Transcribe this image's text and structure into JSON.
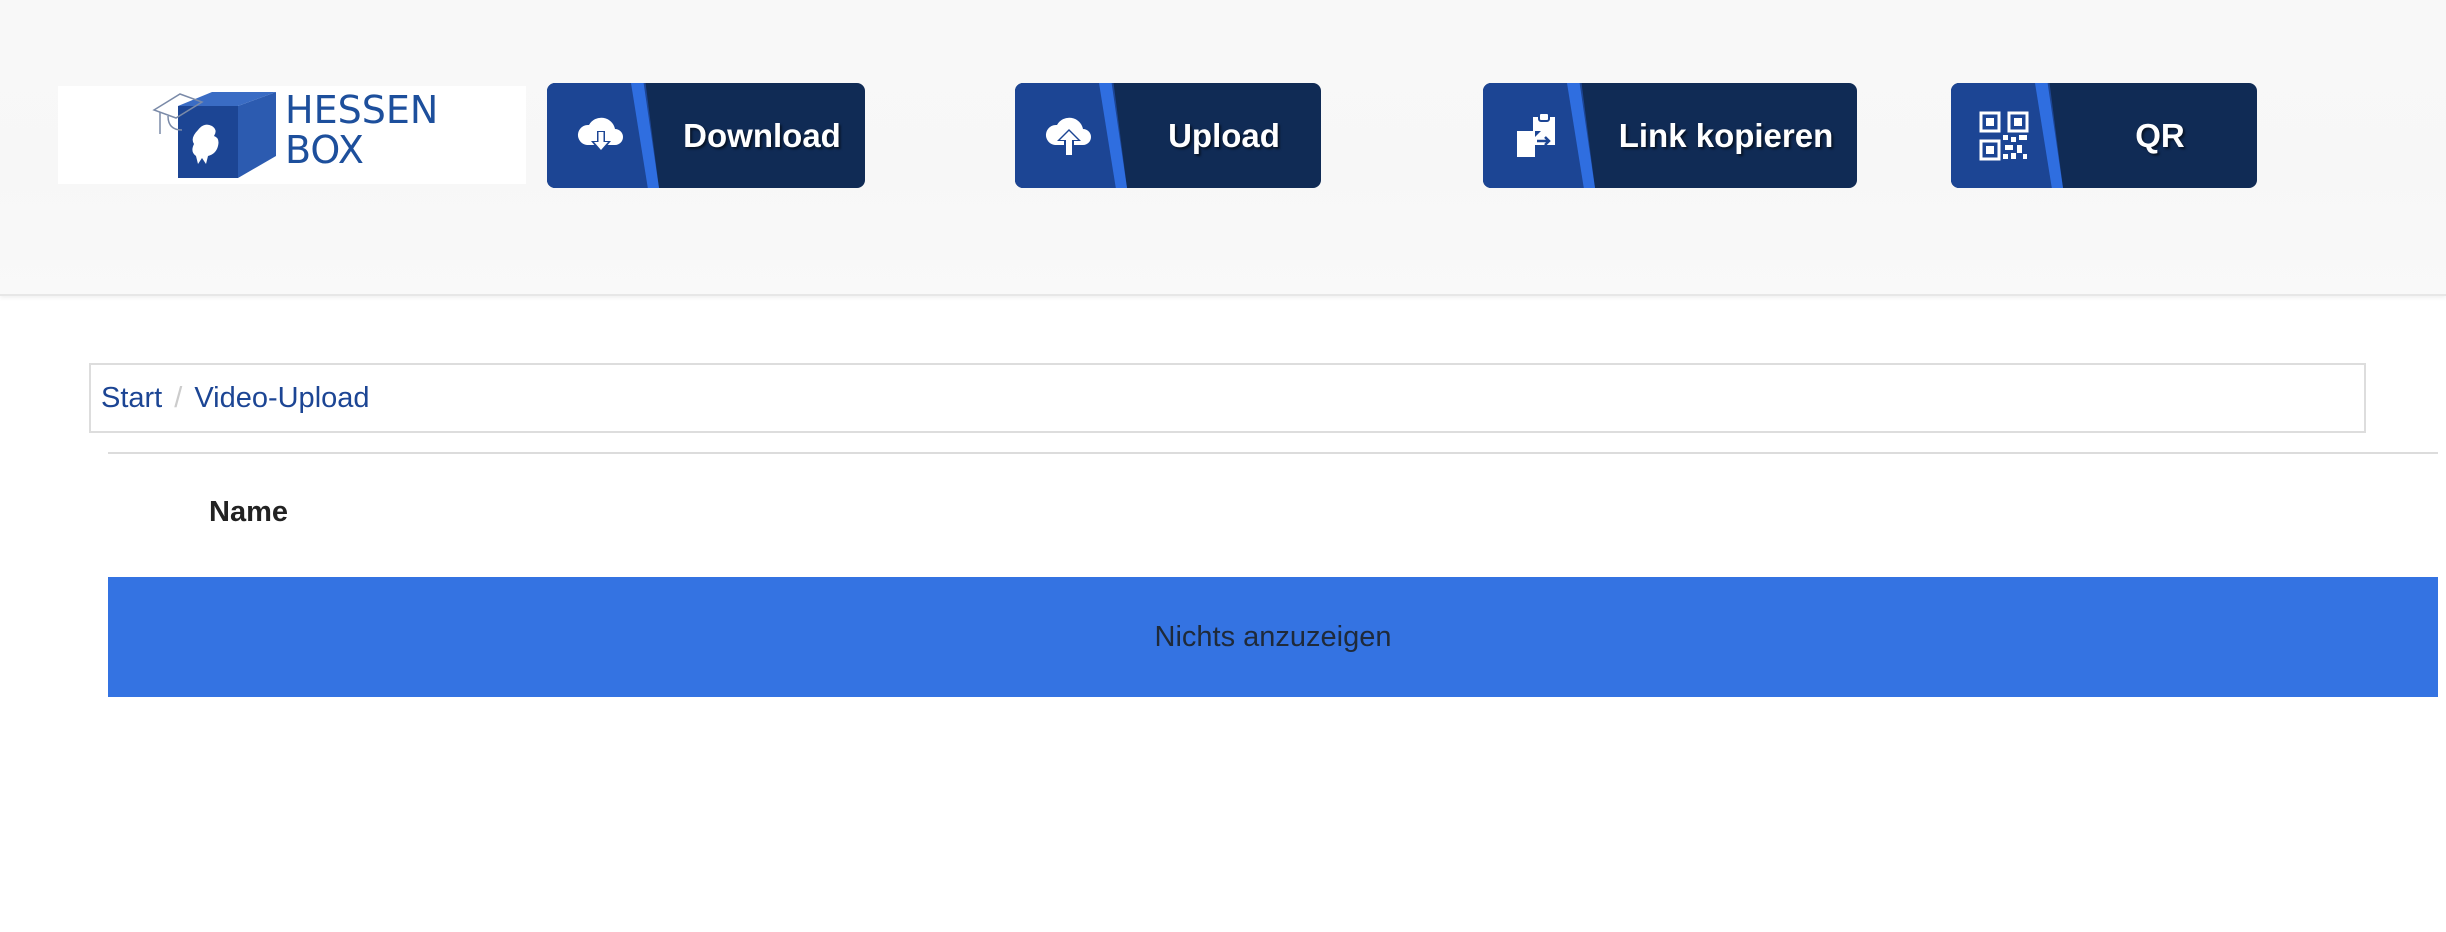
{
  "header": {
    "logo": {
      "line1": "HESSEN",
      "line2": "BOX"
    },
    "buttons": [
      {
        "label": "Download",
        "icon": "cloud-download-icon"
      },
      {
        "label": "Upload",
        "icon": "cloud-upload-icon"
      },
      {
        "label": "Link kopieren",
        "icon": "copy-link-icon"
      },
      {
        "label": "QR",
        "icon": "qr-code-icon"
      }
    ]
  },
  "breadcrumb": {
    "items": [
      "Start",
      "Video-Upload"
    ],
    "separator": "/"
  },
  "table": {
    "columns": [
      "Name"
    ],
    "empty_message": "Nichts anzuzeigen"
  },
  "colors": {
    "brand_dark": "#102b55",
    "brand_mid": "#1c4594",
    "accent": "#2f6ee0",
    "empty_row": "#3473e2",
    "link": "#1c4594"
  }
}
